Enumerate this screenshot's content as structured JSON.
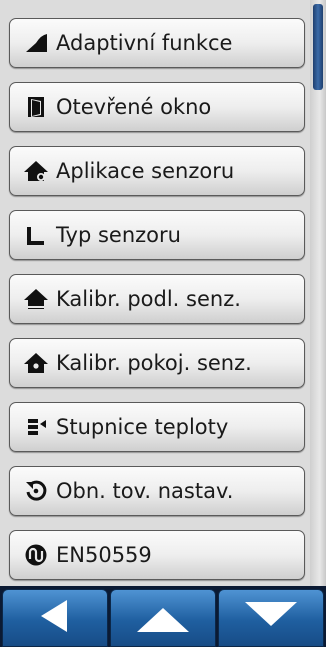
{
  "menu": {
    "items": [
      {
        "label": "Adaptivní funkce",
        "icon": "adaptive-slope-icon"
      },
      {
        "label": "Otevřené okno",
        "icon": "open-window-icon"
      },
      {
        "label": "Aplikace senzoru",
        "icon": "house-sensor-icon"
      },
      {
        "label": "Typ senzoru",
        "icon": "sensor-type-icon"
      },
      {
        "label": "Kalibr. podl. senz.",
        "icon": "house-floor-icon"
      },
      {
        "label": "Kalibr. pokoj. senz.",
        "icon": "house-room-icon"
      },
      {
        "label": "Stupnice teploty",
        "icon": "temperature-scale-icon"
      },
      {
        "label": "Obn. tov. nastav.",
        "icon": "reset-icon"
      },
      {
        "label": "EN50559",
        "icon": "en50559-icon"
      }
    ]
  },
  "scrollbar": {
    "position": 0.0
  },
  "nav": {
    "buttons": [
      {
        "icon": "arrow-left-icon"
      },
      {
        "icon": "arrow-up-icon"
      },
      {
        "icon": "arrow-down-icon"
      }
    ]
  },
  "colors": {
    "icon": "#111111",
    "nav_bg": "#1f5fa0",
    "thumb": "#2d558c"
  }
}
